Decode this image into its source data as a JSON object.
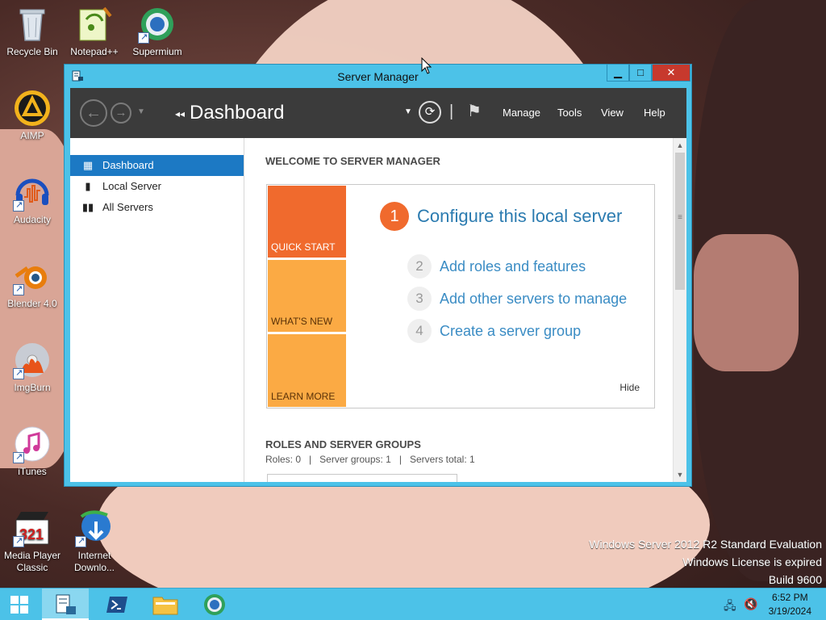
{
  "desktop": {
    "icons": [
      {
        "label": "Recycle Bin",
        "icon": "recycle-bin-icon"
      },
      {
        "label": "Notepad++",
        "icon": "notepad-plus-plus-icon"
      },
      {
        "label": "Supermium",
        "icon": "supermium-browser-icon"
      },
      {
        "label": "AIMP",
        "icon": "aimp-icon"
      },
      {
        "label": "Audacity",
        "icon": "audacity-icon"
      },
      {
        "label": "Blender 4.0",
        "icon": "blender-icon"
      },
      {
        "label": "ImgBurn",
        "icon": "imgburn-icon"
      },
      {
        "label": "iTunes",
        "icon": "itunes-icon"
      },
      {
        "label": "Media Player Classic",
        "icon": "media-player-classic-icon"
      },
      {
        "label": "Internet Downlo...",
        "icon": "internet-download-manager-icon"
      }
    ]
  },
  "window": {
    "title": "Server Manager",
    "buttons": {
      "minimize": "▁",
      "maximize": "□",
      "close": "✕"
    }
  },
  "toolbar": {
    "breadcrumb": "Dashboard",
    "menu": [
      "Manage",
      "Tools",
      "View",
      "Help"
    ]
  },
  "sidebar": {
    "items": [
      {
        "label": "Dashboard",
        "icon": "dashboard-icon",
        "active": true
      },
      {
        "label": "Local Server",
        "icon": "local-server-icon",
        "active": false
      },
      {
        "label": "All Servers",
        "icon": "all-servers-icon",
        "active": false
      }
    ]
  },
  "welcome": {
    "heading": "WELCOME TO SERVER MANAGER",
    "tiles": [
      "QUICK START",
      "WHAT'S NEW",
      "LEARN MORE"
    ],
    "step1": {
      "num": "1",
      "label": "Configure this local server"
    },
    "steps": [
      {
        "num": "2",
        "label": "Add roles and features"
      },
      {
        "num": "3",
        "label": "Add other servers to manage"
      },
      {
        "num": "4",
        "label": "Create a server group"
      }
    ],
    "hide": "Hide"
  },
  "roles": {
    "heading": "ROLES AND SERVER GROUPS",
    "info": "Roles: 0   |   Server groups: 1   |   Servers total: 1"
  },
  "watermark": {
    "line1": "Windows Server 2012 R2 Standard Evaluation",
    "line2": "Windows License is expired",
    "line3": "Build 9600"
  },
  "taskbar": {
    "time": "6:52 PM",
    "date": "3/19/2024"
  },
  "colors": {
    "window_frame": "#4cc2e8",
    "toolbar": "#3b3b3b",
    "accent_orange": "#f06a2d",
    "tile_light": "#fbaa44",
    "active_item": "#1c79c4",
    "close": "#c7392d"
  }
}
